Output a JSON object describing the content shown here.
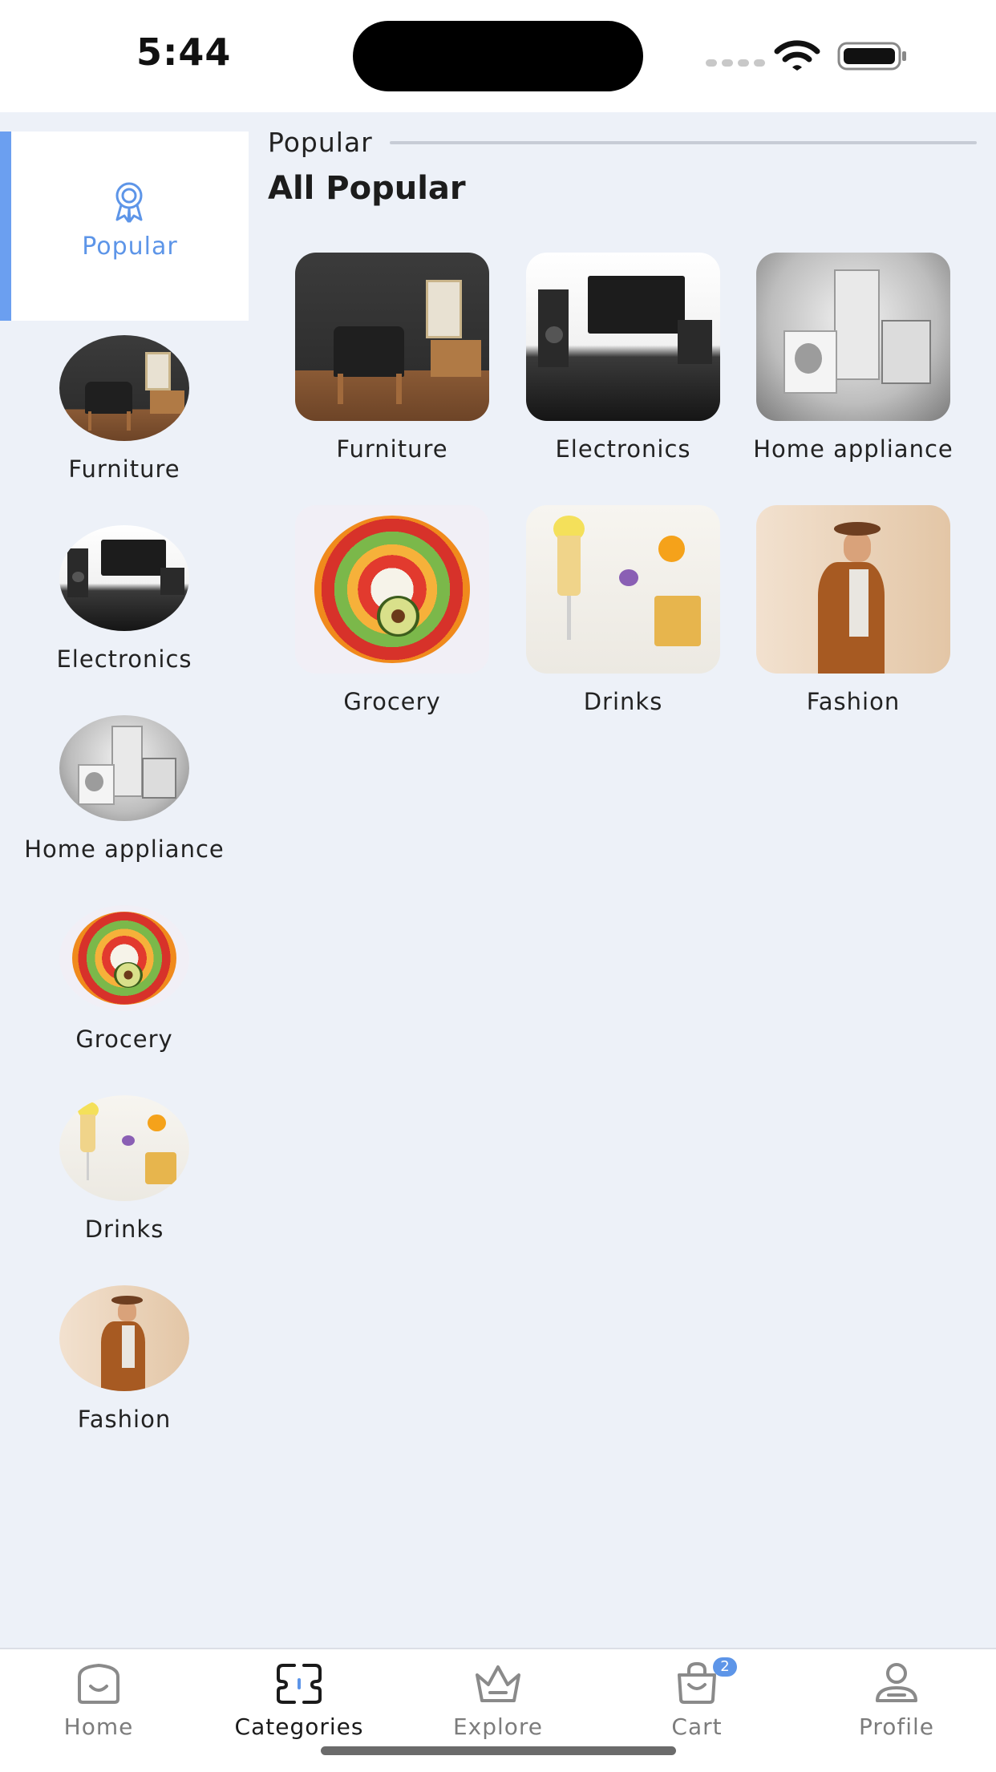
{
  "status_bar": {
    "time": "5:44"
  },
  "sidebar": {
    "active": {
      "label": "Popular",
      "icon": "award-icon"
    },
    "items": [
      {
        "label": "Furniture"
      },
      {
        "label": "Electronics"
      },
      {
        "label": "Home appliance"
      },
      {
        "label": "Grocery"
      },
      {
        "label": "Drinks"
      },
      {
        "label": "Fashion"
      }
    ]
  },
  "content": {
    "section_title": "Popular",
    "heading": "All Popular",
    "grid": [
      {
        "label": "Furniture"
      },
      {
        "label": "Electronics"
      },
      {
        "label": "Home appliance"
      },
      {
        "label": "Grocery"
      },
      {
        "label": "Drinks"
      },
      {
        "label": "Fashion"
      }
    ]
  },
  "tab_bar": {
    "items": [
      {
        "label": "Home",
        "icon": "home-icon"
      },
      {
        "label": "Categories",
        "icon": "categories-icon",
        "active": true
      },
      {
        "label": "Explore",
        "icon": "crown-icon"
      },
      {
        "label": "Cart",
        "icon": "bag-icon",
        "badge": "2"
      },
      {
        "label": "Profile",
        "icon": "person-icon"
      }
    ]
  },
  "colors": {
    "accent": "#5d95e8",
    "background": "#edf1f8"
  }
}
